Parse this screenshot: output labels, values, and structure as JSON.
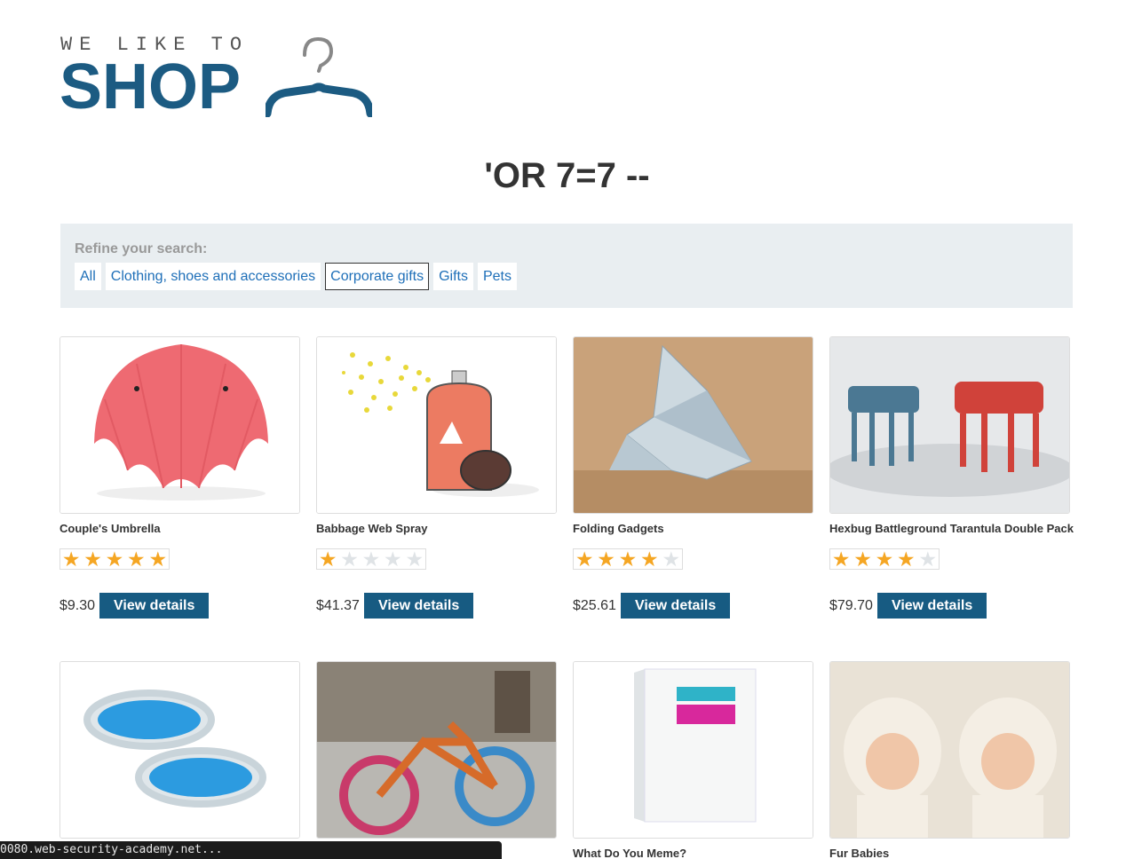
{
  "logo": {
    "small_text": "WE LIKE TO",
    "big_text": "SHOP"
  },
  "search_term": "'OR 7=7 --",
  "filters": {
    "heading": "Refine your search:",
    "items": [
      {
        "label": "All",
        "active": false
      },
      {
        "label": "Clothing, shoes and accessories",
        "active": false
      },
      {
        "label": "Corporate gifts",
        "active": true
      },
      {
        "label": "Gifts",
        "active": false
      },
      {
        "label": "Pets",
        "active": false
      }
    ]
  },
  "view_label": "View details",
  "products": [
    {
      "name": "Couple's Umbrella",
      "rating": 5,
      "price": "$9.30",
      "image": "umbrella"
    },
    {
      "name": "Babbage Web Spray",
      "rating": 1,
      "price": "$41.37",
      "image": "spray"
    },
    {
      "name": "Folding Gadgets",
      "rating": 4,
      "price": "$25.61",
      "image": "origami"
    },
    {
      "name": "Hexbug Battleground Tarantula Double Pack",
      "rating": 4,
      "price": "$79.70",
      "image": "robots"
    },
    {
      "name": "",
      "image": "pools"
    },
    {
      "name": "",
      "image": "bike"
    },
    {
      "name": "What Do You Meme?",
      "image": "meme"
    },
    {
      "name": "Fur Babies",
      "image": "babies"
    }
  ],
  "colors": {
    "brand": "#1c5b82",
    "button": "#175b82",
    "link": "#1e6fb8",
    "star": "#f5a623"
  },
  "status_bar": "0080.web-security-academy.net..."
}
